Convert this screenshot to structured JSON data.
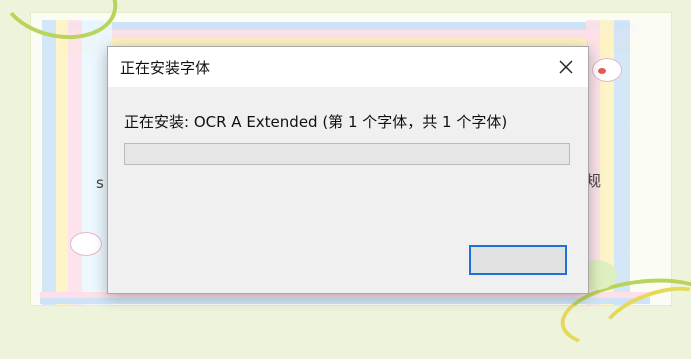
{
  "dialog": {
    "title": "正在安装字体",
    "status_text": "正在安装: OCR A Extended (第 1 个字体，共 1 个字体)",
    "progress_fraction": 0.0,
    "button_label": ""
  },
  "background": {
    "fragments": {
      "left": "s",
      "right": "规"
    }
  },
  "icons": {
    "close": "close-icon"
  },
  "colors": {
    "dialog_bg": "#f0f0f0",
    "titlebar_bg": "#ffffff",
    "focus_border": "#1e73d6",
    "progress_fill": "#06b025",
    "page_bg": "#eef4dc"
  }
}
